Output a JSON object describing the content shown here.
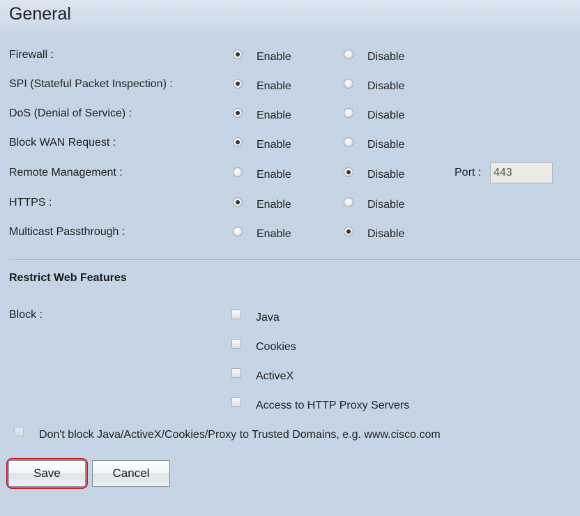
{
  "header": {
    "title": "General"
  },
  "settings": [
    {
      "label": "Firewall :",
      "enable_label": "Enable",
      "disable_label": "Disable",
      "selected": "enable"
    },
    {
      "label": "SPI (Stateful Packet Inspection) :",
      "enable_label": "Enable",
      "disable_label": "Disable",
      "selected": "enable"
    },
    {
      "label": "DoS (Denial of Service) :",
      "enable_label": "Enable",
      "disable_label": "Disable",
      "selected": "enable"
    },
    {
      "label": "Block WAN Request :",
      "enable_label": "Enable",
      "disable_label": "Disable",
      "selected": "enable"
    },
    {
      "label": "Remote Management :",
      "enable_label": "Enable",
      "disable_label": "Disable",
      "selected": "disable"
    },
    {
      "label": "HTTPS :",
      "enable_label": "Enable",
      "disable_label": "Disable",
      "selected": "enable"
    },
    {
      "label": "Multicast Passthrough :",
      "enable_label": "Enable",
      "disable_label": "Disable",
      "selected": "disable"
    }
  ],
  "remote_port": {
    "label": "Port :",
    "value": "443"
  },
  "restrict": {
    "title": "Restrict Web Features",
    "block_label": "Block :",
    "items": [
      {
        "label": "Java",
        "checked": false
      },
      {
        "label": "Cookies",
        "checked": false
      },
      {
        "label": "ActiveX",
        "checked": false
      },
      {
        "label": "Access to HTTP Proxy Servers",
        "checked": false
      }
    ],
    "trusted": {
      "label": "Don't block Java/ActiveX/Cookies/Proxy to Trusted Domains, e.g. www.cisco.com",
      "checked": false
    }
  },
  "buttons": {
    "save": "Save",
    "cancel": "Cancel"
  },
  "colors": {
    "background": "#c5d5e5",
    "highlight": "#d2141e"
  }
}
